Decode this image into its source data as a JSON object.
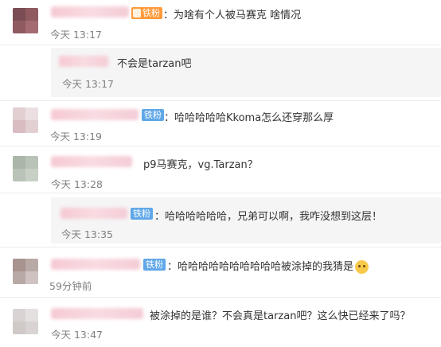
{
  "comments": [
    {
      "badge": "铁粉",
      "text": "：为啥有个人被马赛克 啥情况",
      "time": "今天 13:17"
    },
    {
      "text": "不会是tarzan吧",
      "time": "今天 13:17"
    },
    {
      "badge": "铁粉",
      "text": "：哈哈哈哈哈Kkoma怎么还穿那么厚",
      "time": "今天 13:19"
    },
    {
      "text": "p9马赛克，vg.Tarzan？",
      "time": "今天 13:28"
    },
    {
      "badge": "铁粉",
      "text": "：哈哈哈哈哈哈，兄弟可以啊，我咋没想到这层！",
      "time": "今天 13:35"
    },
    {
      "badge": "铁粉",
      "text": "：哈哈哈哈哈哈哈哈哈哈被涂掉的我猜是",
      "time": "59分钟前"
    },
    {
      "text": "被涂掉的是谁？不会真是tarzan吧？这么快已经来了吗？",
      "time": "今天 13:47"
    }
  ]
}
